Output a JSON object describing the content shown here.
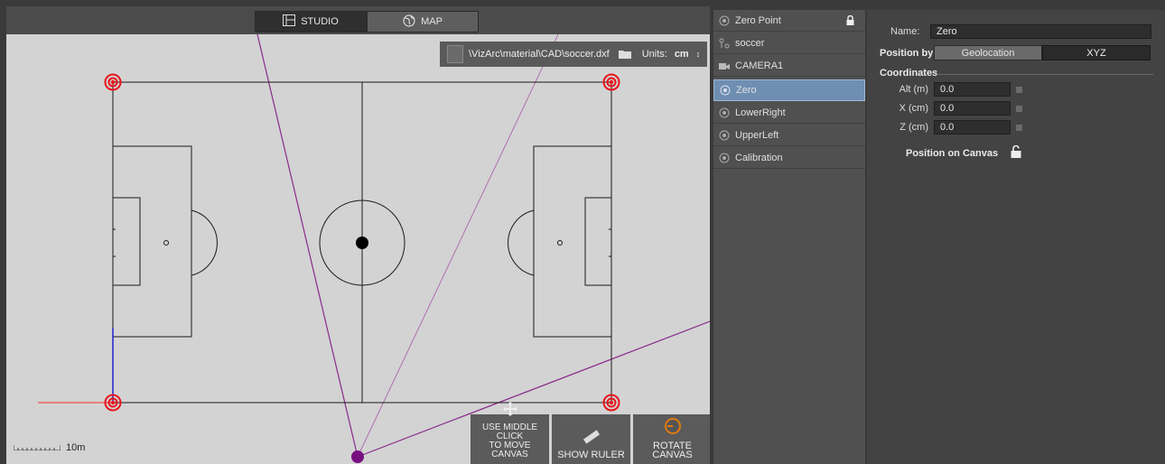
{
  "mode_tabs": {
    "studio_label": "STUDIO",
    "map_label": "MAP",
    "active": "STUDIO"
  },
  "file_bar": {
    "path": "\\VizArc\\material\\CAD\\soccer.dxf",
    "units_label": "Units:",
    "units_value": "cm"
  },
  "scale": {
    "label": "10m"
  },
  "tools": {
    "move": {
      "line1": "USE MIDDLE CLICK",
      "line2": "TO MOVE CANVAS"
    },
    "ruler": {
      "label": "SHOW RULER"
    },
    "rotate": {
      "label": "ROTATE CANVAS"
    }
  },
  "list": {
    "items": [
      {
        "label": "Zero Point",
        "icon": "target-icon",
        "locked": true
      },
      {
        "label": "soccer",
        "icon": "path-icon"
      },
      {
        "label": "CAMERA1",
        "icon": "camera-icon"
      },
      {
        "label": "Zero",
        "icon": "target-icon",
        "selected": true
      },
      {
        "label": "LowerRight",
        "icon": "target-icon"
      },
      {
        "label": "UpperLeft",
        "icon": "target-icon"
      },
      {
        "label": "Calibration",
        "icon": "target-icon"
      }
    ]
  },
  "props": {
    "name_label": "Name:",
    "name_value": "Zero",
    "position_by_label": "Position by",
    "geolocation_label": "Geolocation",
    "xyz_label": "XYZ",
    "position_by_selected": "XYZ",
    "coordinates_title": "Coordinates",
    "alt_label": "Alt (m)",
    "alt_value": "0.0",
    "x_label": "X (cm)",
    "x_value": "0.0",
    "z_label": "Z (cm)",
    "z_value": "0.0",
    "position_on_canvas_label": "Position on Canvas"
  },
  "colors": {
    "canvas_bg": "#d3d3d3",
    "marker_red": "#e8141c",
    "camera_line": "#8a2a8a",
    "camera_dot": "#7a1080",
    "selected_item": "#6e8eb2",
    "x_axis": "#ff2a2a",
    "z_axis": "#2222cc"
  }
}
